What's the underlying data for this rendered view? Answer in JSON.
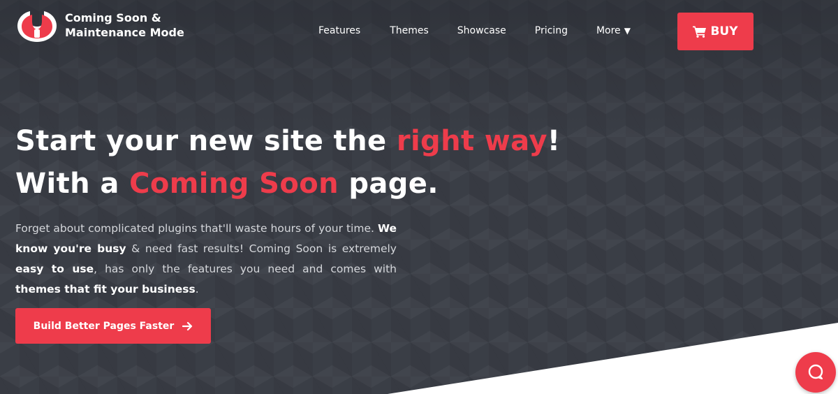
{
  "brand": {
    "name_line1": "Coming Soon &",
    "name_line2": "Maintenance Mode",
    "logo_icon": "wrench-shield-logo-icon"
  },
  "nav": {
    "items": [
      {
        "label": "Features"
      },
      {
        "label": "Themes"
      },
      {
        "label": "Showcase"
      },
      {
        "label": "Pricing"
      },
      {
        "label": "More"
      }
    ],
    "more_caret": "▼"
  },
  "buy_button": {
    "label": "BUY",
    "icon": "cart-icon"
  },
  "hero": {
    "line1_before": "Start your new site the ",
    "line1_accent": "right way",
    "line1_after": "!",
    "line2_before": "With a ",
    "line2_accent": "Coming Soon",
    "line2_after": " page.",
    "intro": {
      "t1": "Forget about complicated plugins that'll waste hours of your time. ",
      "b1": "We know you're busy",
      "t2": " & need fast results! Coming Soon is extremely ",
      "b2": "easy to use",
      "t3": ", has only the features you need and comes with ",
      "b3": "themes that fit your business",
      "t4": "."
    },
    "cta_label": "Build Better Pages Faster",
    "cta_icon": "arrow-right-icon"
  },
  "chat": {
    "icon": "chat-bubble-icon"
  },
  "colors": {
    "accent": "#ee3c4b",
    "background": "#3a3e46",
    "text": "#ffffff"
  }
}
